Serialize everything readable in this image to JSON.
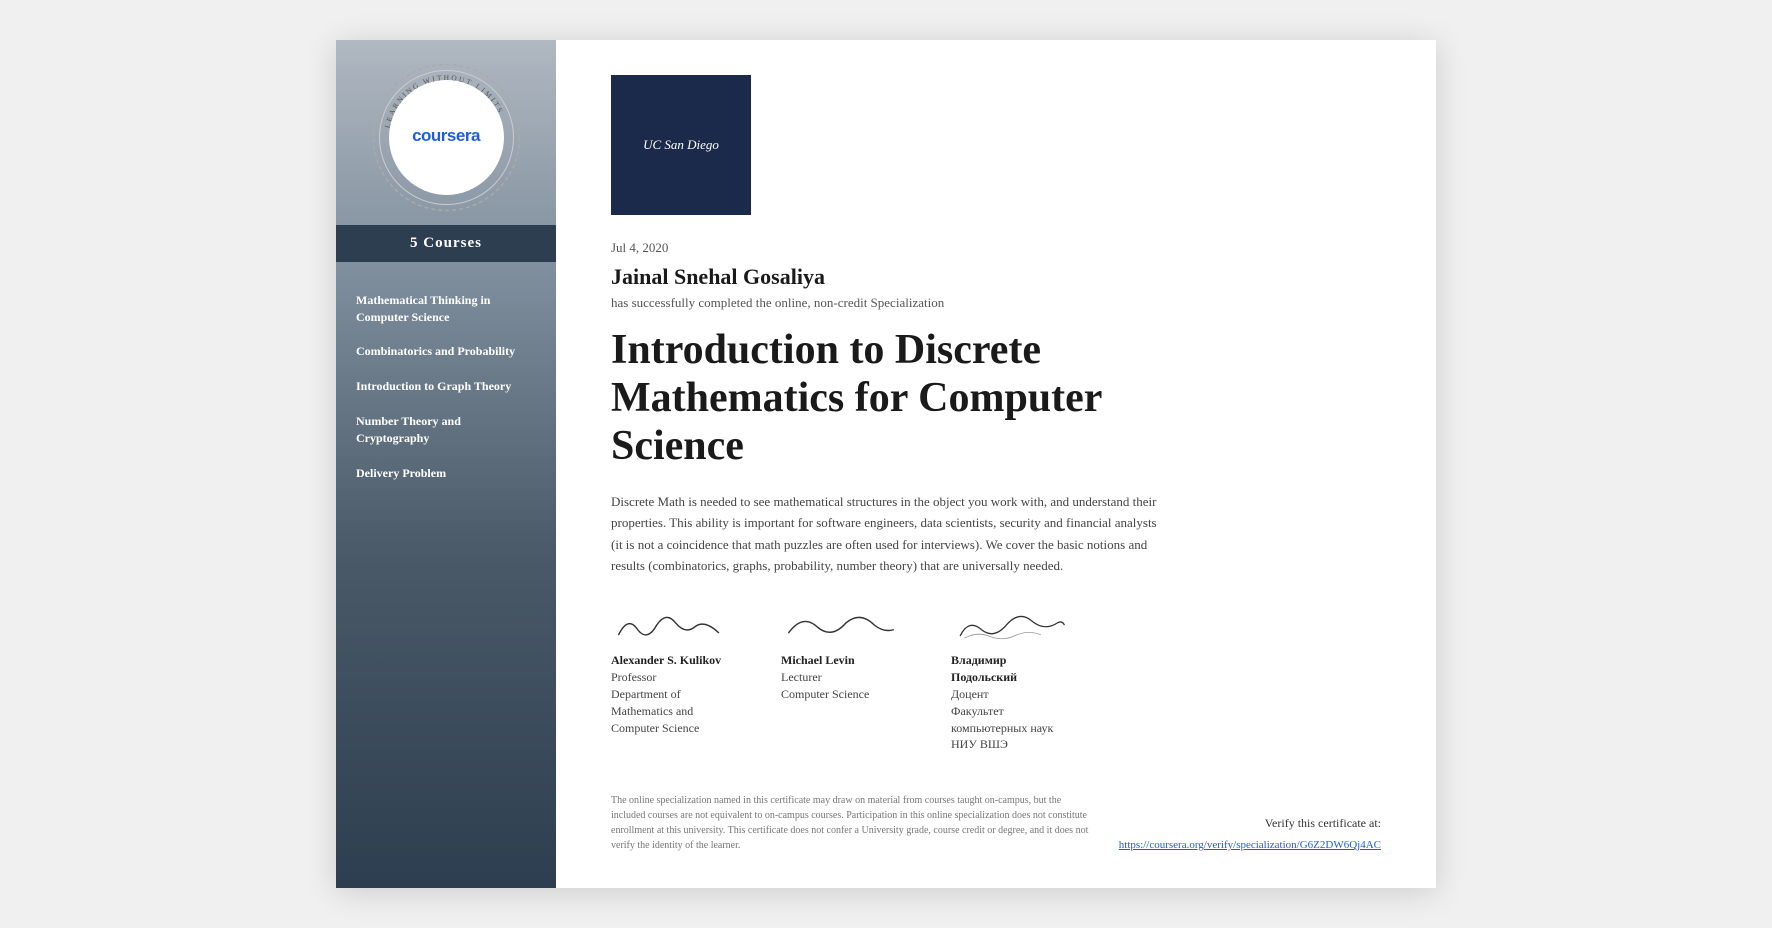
{
  "sidebar": {
    "courses_count": "5 Courses",
    "courses": [
      {
        "id": 1,
        "label": "Mathematical Thinking in Computer Science"
      },
      {
        "id": 2,
        "label": "Combinatorics and Probability"
      },
      {
        "id": 3,
        "label": "Introduction to Graph Theory"
      },
      {
        "id": 4,
        "label": "Number Theory and Cryptography"
      },
      {
        "id": 5,
        "label": "Delivery Problem"
      }
    ]
  },
  "header": {
    "university_line1": "UC San Diego",
    "university_line2": ""
  },
  "certificate": {
    "date": "Jul 4, 2020",
    "recipient_name": "Jainal Snehal Gosaliya",
    "completion_text": "has successfully completed the online, non-credit Specialization",
    "title": "Introduction to Discrete Mathematics for Computer Science",
    "description": "Discrete Math is needed to see mathematical structures in the object you work with, and understand their properties. This ability is important for software engineers, data scientists, security and financial analysts (it is not a coincidence that math puzzles are often used for interviews). We cover the basic notions and results (combinatorics, graphs, probability, number theory) that are universally needed."
  },
  "signatories": [
    {
      "name": "Alexander S. Kulikov",
      "role": "Professor\nDepartment of\nMathematics and\nComputer Science"
    },
    {
      "name": "Michael Levin",
      "role": "Lecturer\nComputer Science"
    },
    {
      "name": "Владимир\nПодольский",
      "role": "Доцент\nФакультет\nкомпьютерных наук\nНИУ ВШЭ"
    }
  ],
  "footer": {
    "disclaimer": "The online specialization named in this certificate may draw on material from courses taught on-campus, but the included courses are not equivalent to on-campus courses. Participation in this online specialization does not constitute enrollment at this university. This certificate does not confer a University grade, course credit or degree, and it does not verify the identity of the learner.",
    "verify_label": "Verify this certificate at:",
    "verify_url": "https://coursera.org/verify/specialization/G6Z2DW6Qj4AC"
  }
}
